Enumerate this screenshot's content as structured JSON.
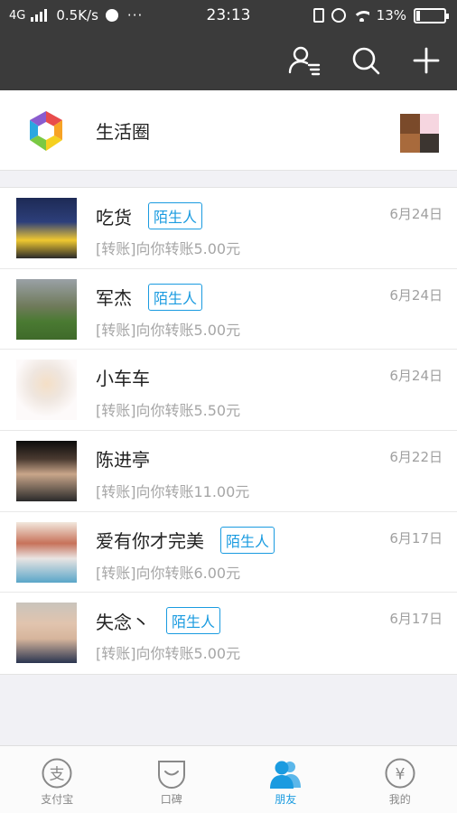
{
  "status_bar": {
    "network": "4G",
    "speed": "0.5K/s",
    "more": "···",
    "time": "23:13",
    "battery": "13%",
    "battery_level": 0.13
  },
  "header": {
    "icons": [
      "contacts-menu-icon",
      "search-icon",
      "plus-icon"
    ]
  },
  "life_circle": {
    "label": "生活圈"
  },
  "conversations": [
    {
      "name": "吃货",
      "badge": "陌生人",
      "date": "6月24日",
      "message": "[转账]向你转账5.00元"
    },
    {
      "name": "军杰",
      "badge": "陌生人",
      "date": "6月24日",
      "message": "[转账]向你转账5.00元"
    },
    {
      "name": "小车车",
      "badge": "",
      "date": "6月24日",
      "message": "[转账]向你转账5.50元"
    },
    {
      "name": "陈进亭",
      "badge": "",
      "date": "6月22日",
      "message": "[转账]向你转账11.00元"
    },
    {
      "name": "爱有你才完美",
      "badge": "陌生人",
      "date": "6月17日",
      "message": "[转账]向你转账6.00元"
    },
    {
      "name": "失念丶",
      "badge": "陌生人",
      "date": "6月17日",
      "message": "[转账]向你转账5.00元"
    }
  ],
  "tabs": [
    {
      "label": "支付宝",
      "icon": "alipay-icon",
      "active": false
    },
    {
      "label": "口碑",
      "icon": "koubei-icon",
      "active": false
    },
    {
      "label": "朋友",
      "icon": "friends-icon",
      "active": true
    },
    {
      "label": "我的",
      "icon": "yuan-icon",
      "active": false
    }
  ],
  "colors": {
    "header_bg": "#3b3b3b",
    "accent": "#1a9be0",
    "muted_text": "#a6a6a6"
  }
}
